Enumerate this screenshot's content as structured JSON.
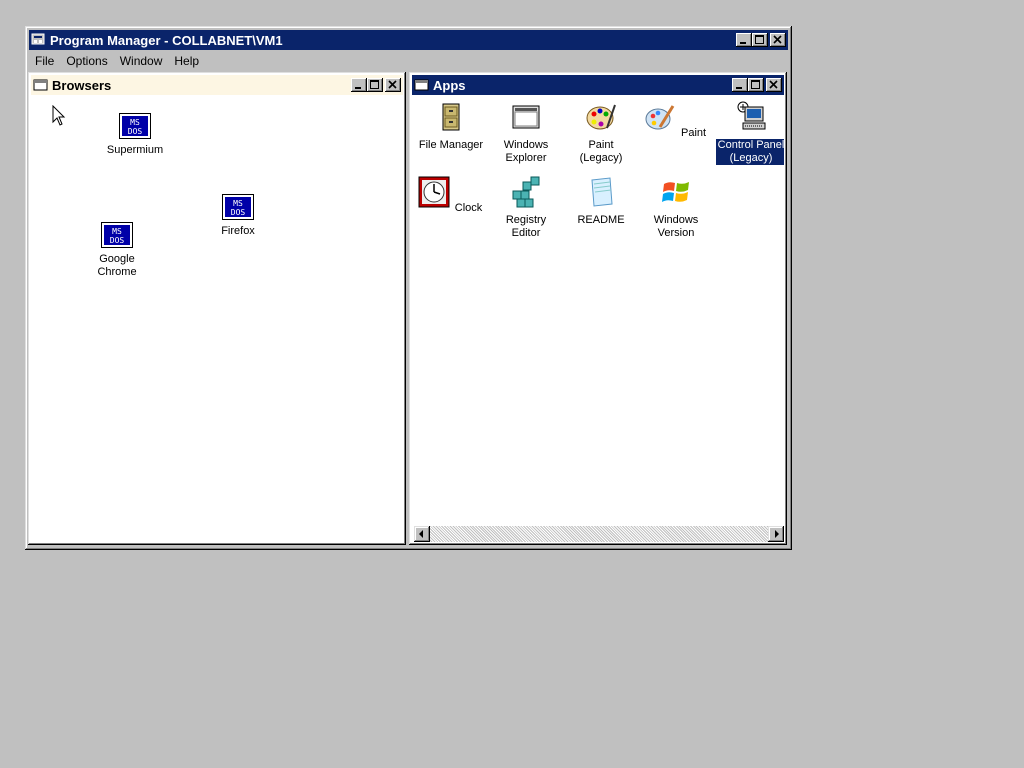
{
  "program_manager": {
    "title": "Program Manager - COLLABNET\\VM1",
    "menu": [
      "File",
      "Options",
      "Window",
      "Help"
    ]
  },
  "browsers": {
    "title": "Browsers",
    "icons": [
      {
        "label": "Supermium",
        "icon": "msdos-icon"
      },
      {
        "label": "Firefox",
        "icon": "msdos-icon"
      },
      {
        "label": "Google\nChrome",
        "icon": "msdos-icon"
      }
    ]
  },
  "apps": {
    "title": "Apps",
    "icons": [
      {
        "label": "File Manager",
        "icon": "file-cabinet-icon"
      },
      {
        "label": "Windows\nExplorer",
        "icon": "window-icon"
      },
      {
        "label": "Paint (Legacy)",
        "icon": "palette-icon"
      },
      {
        "label": "Paint",
        "icon": "palette-brush-icon"
      },
      {
        "label": "Control Panel\n(Legacy)",
        "icon": "control-panel-icon",
        "selected": true
      },
      {
        "label": "Clock",
        "icon": "clock-icon"
      },
      {
        "label": "Registry Editor",
        "icon": "registry-cubes-icon"
      },
      {
        "label": "README",
        "icon": "notepad-icon"
      },
      {
        "label": "Windows\nVersion",
        "icon": "windows-logo-icon"
      }
    ]
  },
  "colors": {
    "active_title": "#0a246a",
    "inactive_title": "#fdf6e3",
    "desktop": "#c0c0c0"
  }
}
